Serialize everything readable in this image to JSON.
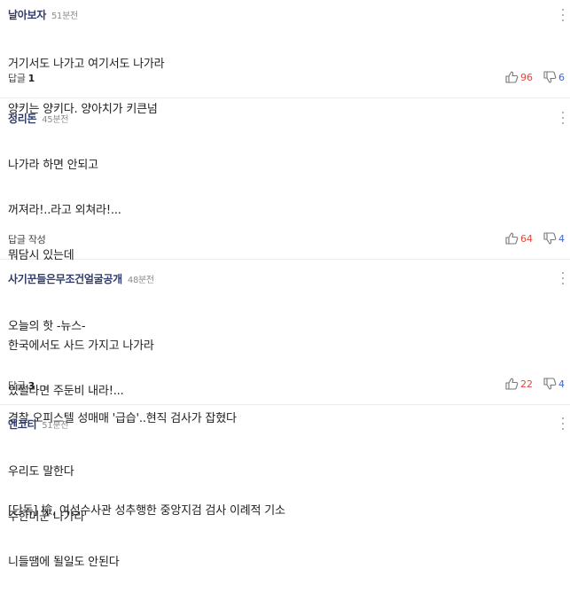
{
  "comments": [
    {
      "nickname": "날아보자",
      "time": "51분전",
      "lines": [
        "거기서도 나가고 여기서도 나가라",
        "양키는 양키다. 양아치가 키큰넘"
      ],
      "reply_label": "답글",
      "reply_count": "1",
      "likes": "96",
      "dislikes": "6"
    },
    {
      "nickname": "정리돈",
      "time": "45분전",
      "lines": [
        "나가라 하면 안되고",
        "꺼져라!..라고 외쳐라!...",
        "뭐담시 있는데",
        "",
        "한국에서도 사드 가지고 나가라",
        "있썰라면 주둔비 내라!..."
      ],
      "reply_label": "답글 작성",
      "reply_count": "",
      "likes": "64",
      "dislikes": "4"
    },
    {
      "nickname": "사기꾼들은무조건얼굴공개",
      "time": "48분전",
      "lines": [
        "오늘의 핫 -뉴스-",
        "",
        "경찰 오피스텔 성매매 '급습'..현직 검사가 잡혔다",
        "",
        "[단독] 檢, 여성수사관 성추행한 중앙지검 검사 이례적 기소"
      ],
      "reply_label": "답글",
      "reply_count": "3",
      "likes": "22",
      "dislikes": "4"
    },
    {
      "nickname": "엔코티",
      "time": "51분전",
      "lines": [
        "우리도 말한다",
        "주한미군 나가라",
        "니들땜에 될일도 안된다"
      ],
      "reply_label": "",
      "reply_count": "",
      "likes": "",
      "dislikes": ""
    }
  ]
}
